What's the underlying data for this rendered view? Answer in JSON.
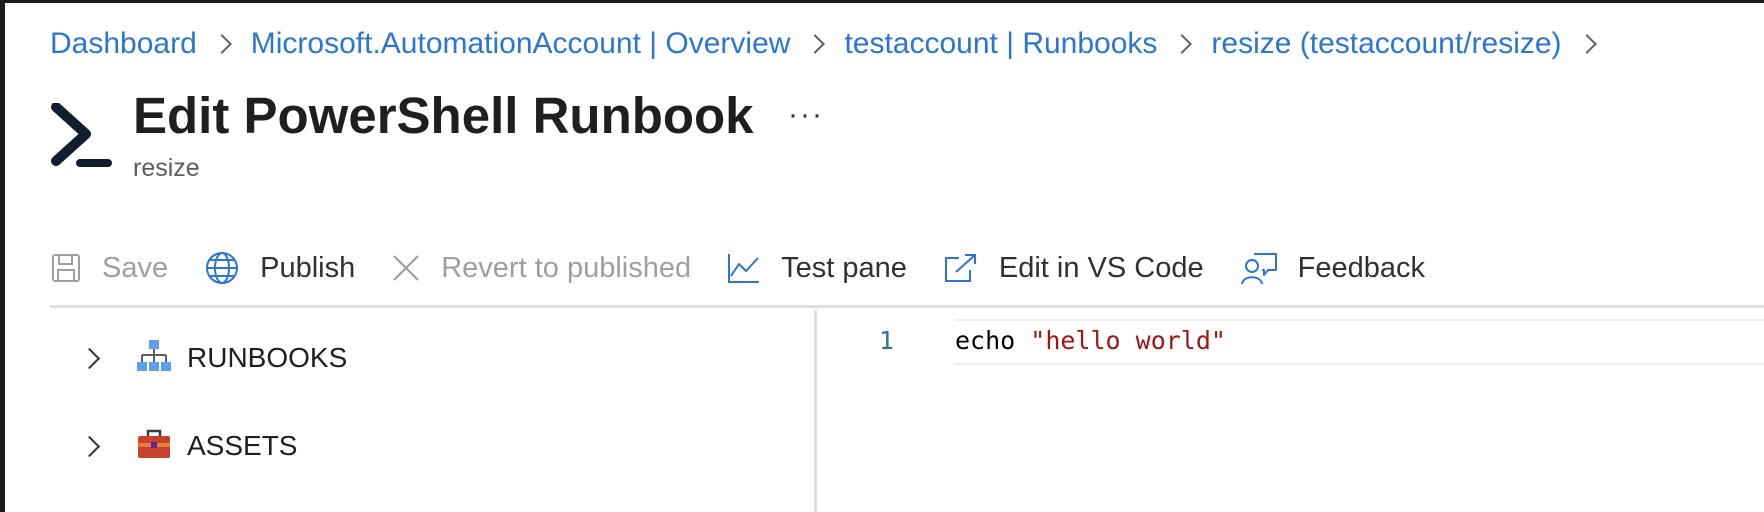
{
  "breadcrumb": {
    "items": [
      {
        "label": "Dashboard"
      },
      {
        "label": "Microsoft.AutomationAccount | Overview"
      },
      {
        "label": "testaccount | Runbooks"
      },
      {
        "label": "resize (testaccount/resize)"
      }
    ]
  },
  "header": {
    "title": "Edit PowerShell Runbook",
    "subtitle": "resize",
    "more_label": "···",
    "icon": "powershell-icon"
  },
  "toolbar": {
    "save": {
      "label": "Save",
      "icon": "save-icon",
      "disabled": true
    },
    "publish": {
      "label": "Publish",
      "icon": "globe-icon"
    },
    "revert": {
      "label": "Revert to published",
      "icon": "close-icon",
      "disabled": true
    },
    "test_pane": {
      "label": "Test pane",
      "icon": "chart-line-icon"
    },
    "vscode": {
      "label": "Edit in VS Code",
      "icon": "open-external-icon"
    },
    "feedback": {
      "label": "Feedback",
      "icon": "feedback-icon"
    }
  },
  "tree": {
    "items": [
      {
        "label": "RUNBOOKS",
        "icon": "hierarchy-icon"
      },
      {
        "label": "ASSETS",
        "icon": "toolbox-icon"
      }
    ]
  },
  "editor": {
    "lines": [
      {
        "number": "1",
        "command": "echo",
        "argument": "\"hello world\""
      }
    ]
  },
  "colors": {
    "link": "#2b76d2",
    "string": "#a31515",
    "line_number": "#237893",
    "disabled": "#a19f9d"
  }
}
